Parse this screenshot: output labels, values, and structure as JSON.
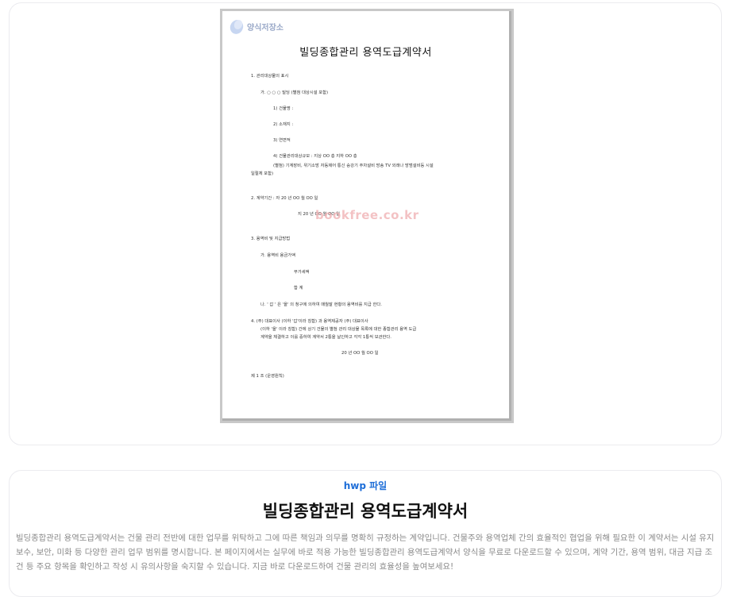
{
  "preview": {
    "logo_text": "양식저장소",
    "watermark": "bookfree.co.kr",
    "document": {
      "title": "빌딩종합관리 용역도급계약서",
      "lines": [
        "1. 관리대상물의 표시",
        "가.   ○ ○ ○  빌딩 (별첨    대상시설 포함)",
        "1) 건물명 :",
        "2) 소재지 :",
        "3) 연면적",
        "4) 건물관리대상규모 : 지상  OO 층          지하  OO  층",
        "(별첨) 기계장비, 위기소방 자동제어 통신 승강기 주차설비 방송 TV 외래나 방범설비등 시설",
        "일절체 포함)",
        "2. 계약기간 :          자   20      년       OO   월    OO     일",
        "지    20       년      OO   월    OO   일",
        "3. 용역비 및 지급방법",
        "가. 용역비    용금가액",
        "부가세액",
        "합         계",
        "나. ' 갑 ' 은 '을' 의 청구에 의하여 매월말 현황의 용역비를 지급 한다.",
        "4.           (주) 대표이사 (이하 '갑'이라 칭함) 과 용역제공자            (주) 대표이사",
        "(이하 '을' 이라 칭함) 간에 상기 건물의 별첨 관리 대상물 목록에 대한 종합관리 용역 도급",
        "계약을 체결하고 이를 증하여 계약서 2통을 날인하고 각각 1통씩 보관한다.",
        "20     년       OO   월       OO   일",
        "제 1 조 (운영원칙)"
      ]
    }
  },
  "info": {
    "badge": "hwp 파일",
    "title": "빌딩종합관리 용역도급계약서",
    "description": "빌딩종합관리 용역도급계약서는 건물 관리 전반에 대한 업무를 위탁하고 그에 따른 책임과 의무를 명확히 규정하는 계약입니다. 건물주와 용역업체 간의 효율적인 협업을 위해 필요한 이 계약서는 시설 유지보수, 보안, 미화 등 다양한 관리 업무 범위를 명시합니다. 본 페이지에서는 실무에 바로 적용 가능한 빌딩종합관리 용역도급계약서 양식을 무료로 다운로드할 수 있으며, 계약 기간, 용역 범위, 대금 지급 조건 등 주요 항목을 확인하고 작성 시 유의사항을 숙지할 수 있습니다. 지금 바로 다운로드하여 건물 관리의 효율성을 높여보세요!"
  },
  "colors": {
    "badge": "#1e6ed8",
    "watermark": "#f0aeb1",
    "description": "#8a8a8a"
  }
}
